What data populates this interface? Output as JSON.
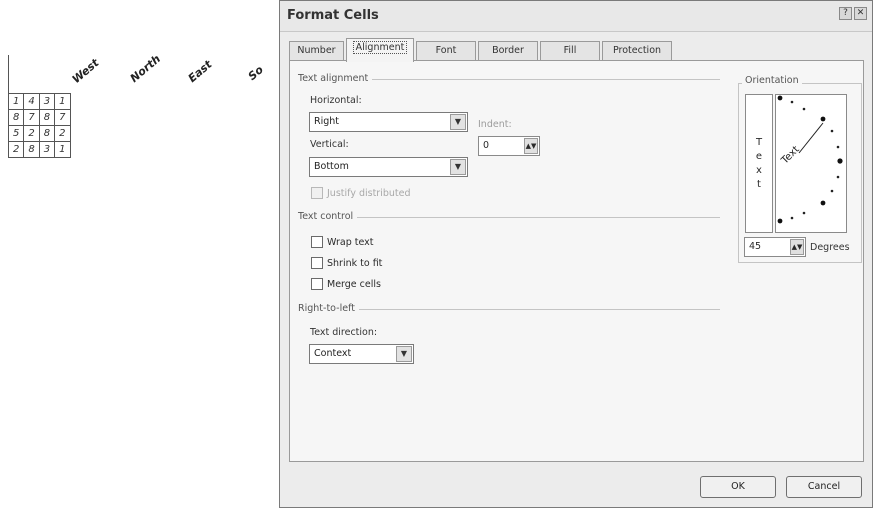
{
  "sheet": {
    "headers": [
      "West",
      "North",
      "East",
      "So"
    ],
    "rows": [
      [
        "1",
        "4",
        "3",
        "1"
      ],
      [
        "8",
        "7",
        "8",
        "7"
      ],
      [
        "5",
        "2",
        "8",
        "2"
      ],
      [
        "2",
        "8",
        "3",
        "1"
      ]
    ]
  },
  "dialog": {
    "title": "Format Cells",
    "help_glyph": "?",
    "close_glyph": "✕",
    "tabs": [
      "Number",
      "Alignment",
      "Font",
      "Border",
      "Fill",
      "Protection"
    ],
    "active_tab": "Alignment"
  },
  "text_alignment": {
    "group_label": "Text alignment",
    "horizontal_label": "Horizontal:",
    "horizontal_value": "Right",
    "vertical_label": "Vertical:",
    "vertical_value": "Bottom",
    "indent_label": "Indent:",
    "indent_value": "0",
    "justify_distributed_label": "Justify distributed"
  },
  "text_control": {
    "group_label": "Text control",
    "wrap_text_label": "Wrap text",
    "shrink_to_fit_label": "Shrink to fit",
    "merge_cells_label": "Merge cells"
  },
  "rtl": {
    "group_label": "Right-to-left",
    "text_direction_label": "Text direction:",
    "text_direction_value": "Context"
  },
  "orientation": {
    "group_label": "Orientation",
    "vertical_text": [
      "T",
      "e",
      "x",
      "t"
    ],
    "dial_text": "Text",
    "degrees_value": "45",
    "degrees_label": "Degrees"
  },
  "buttons": {
    "ok_label": "OK",
    "cancel_label": "Cancel"
  },
  "icons": {
    "dropdown": "chevron-down-icon",
    "spinner": "spinner-icon"
  },
  "colors": {
    "dialog_bg": "#ececec",
    "panel_bg": "#f6f6f6",
    "border": "#7a7a7a"
  }
}
